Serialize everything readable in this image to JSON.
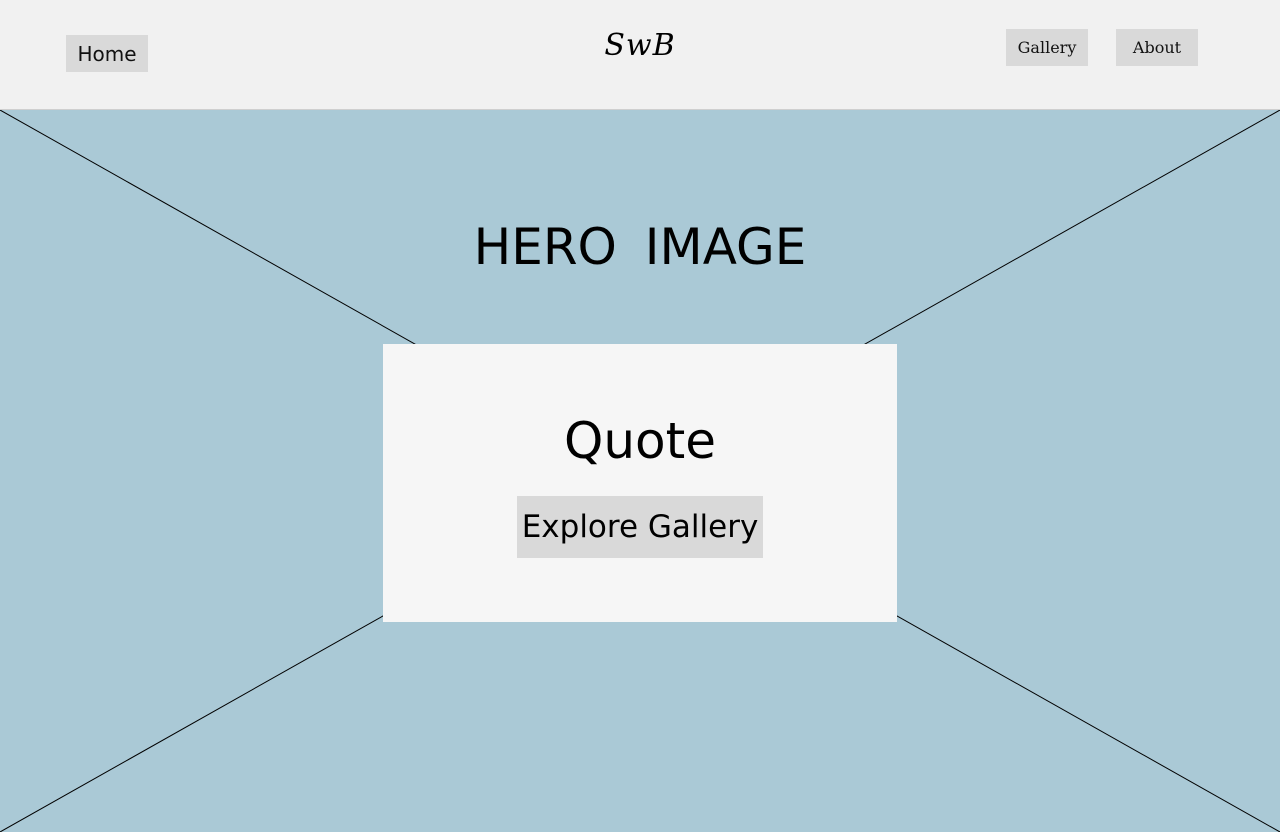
{
  "header": {
    "home_label": "Home",
    "logo_text": "SwB",
    "gallery_label": "Gallery",
    "about_label": "About"
  },
  "hero": {
    "title": "HERO  IMAGE",
    "quote": "Quote",
    "cta_label": "Explore Gallery"
  },
  "colors": {
    "header_bg": "#f1f1f1",
    "hero_bg": "#aac9d6",
    "button_bg": "#d9d9d9",
    "card_bg": "#f6f6f6"
  }
}
